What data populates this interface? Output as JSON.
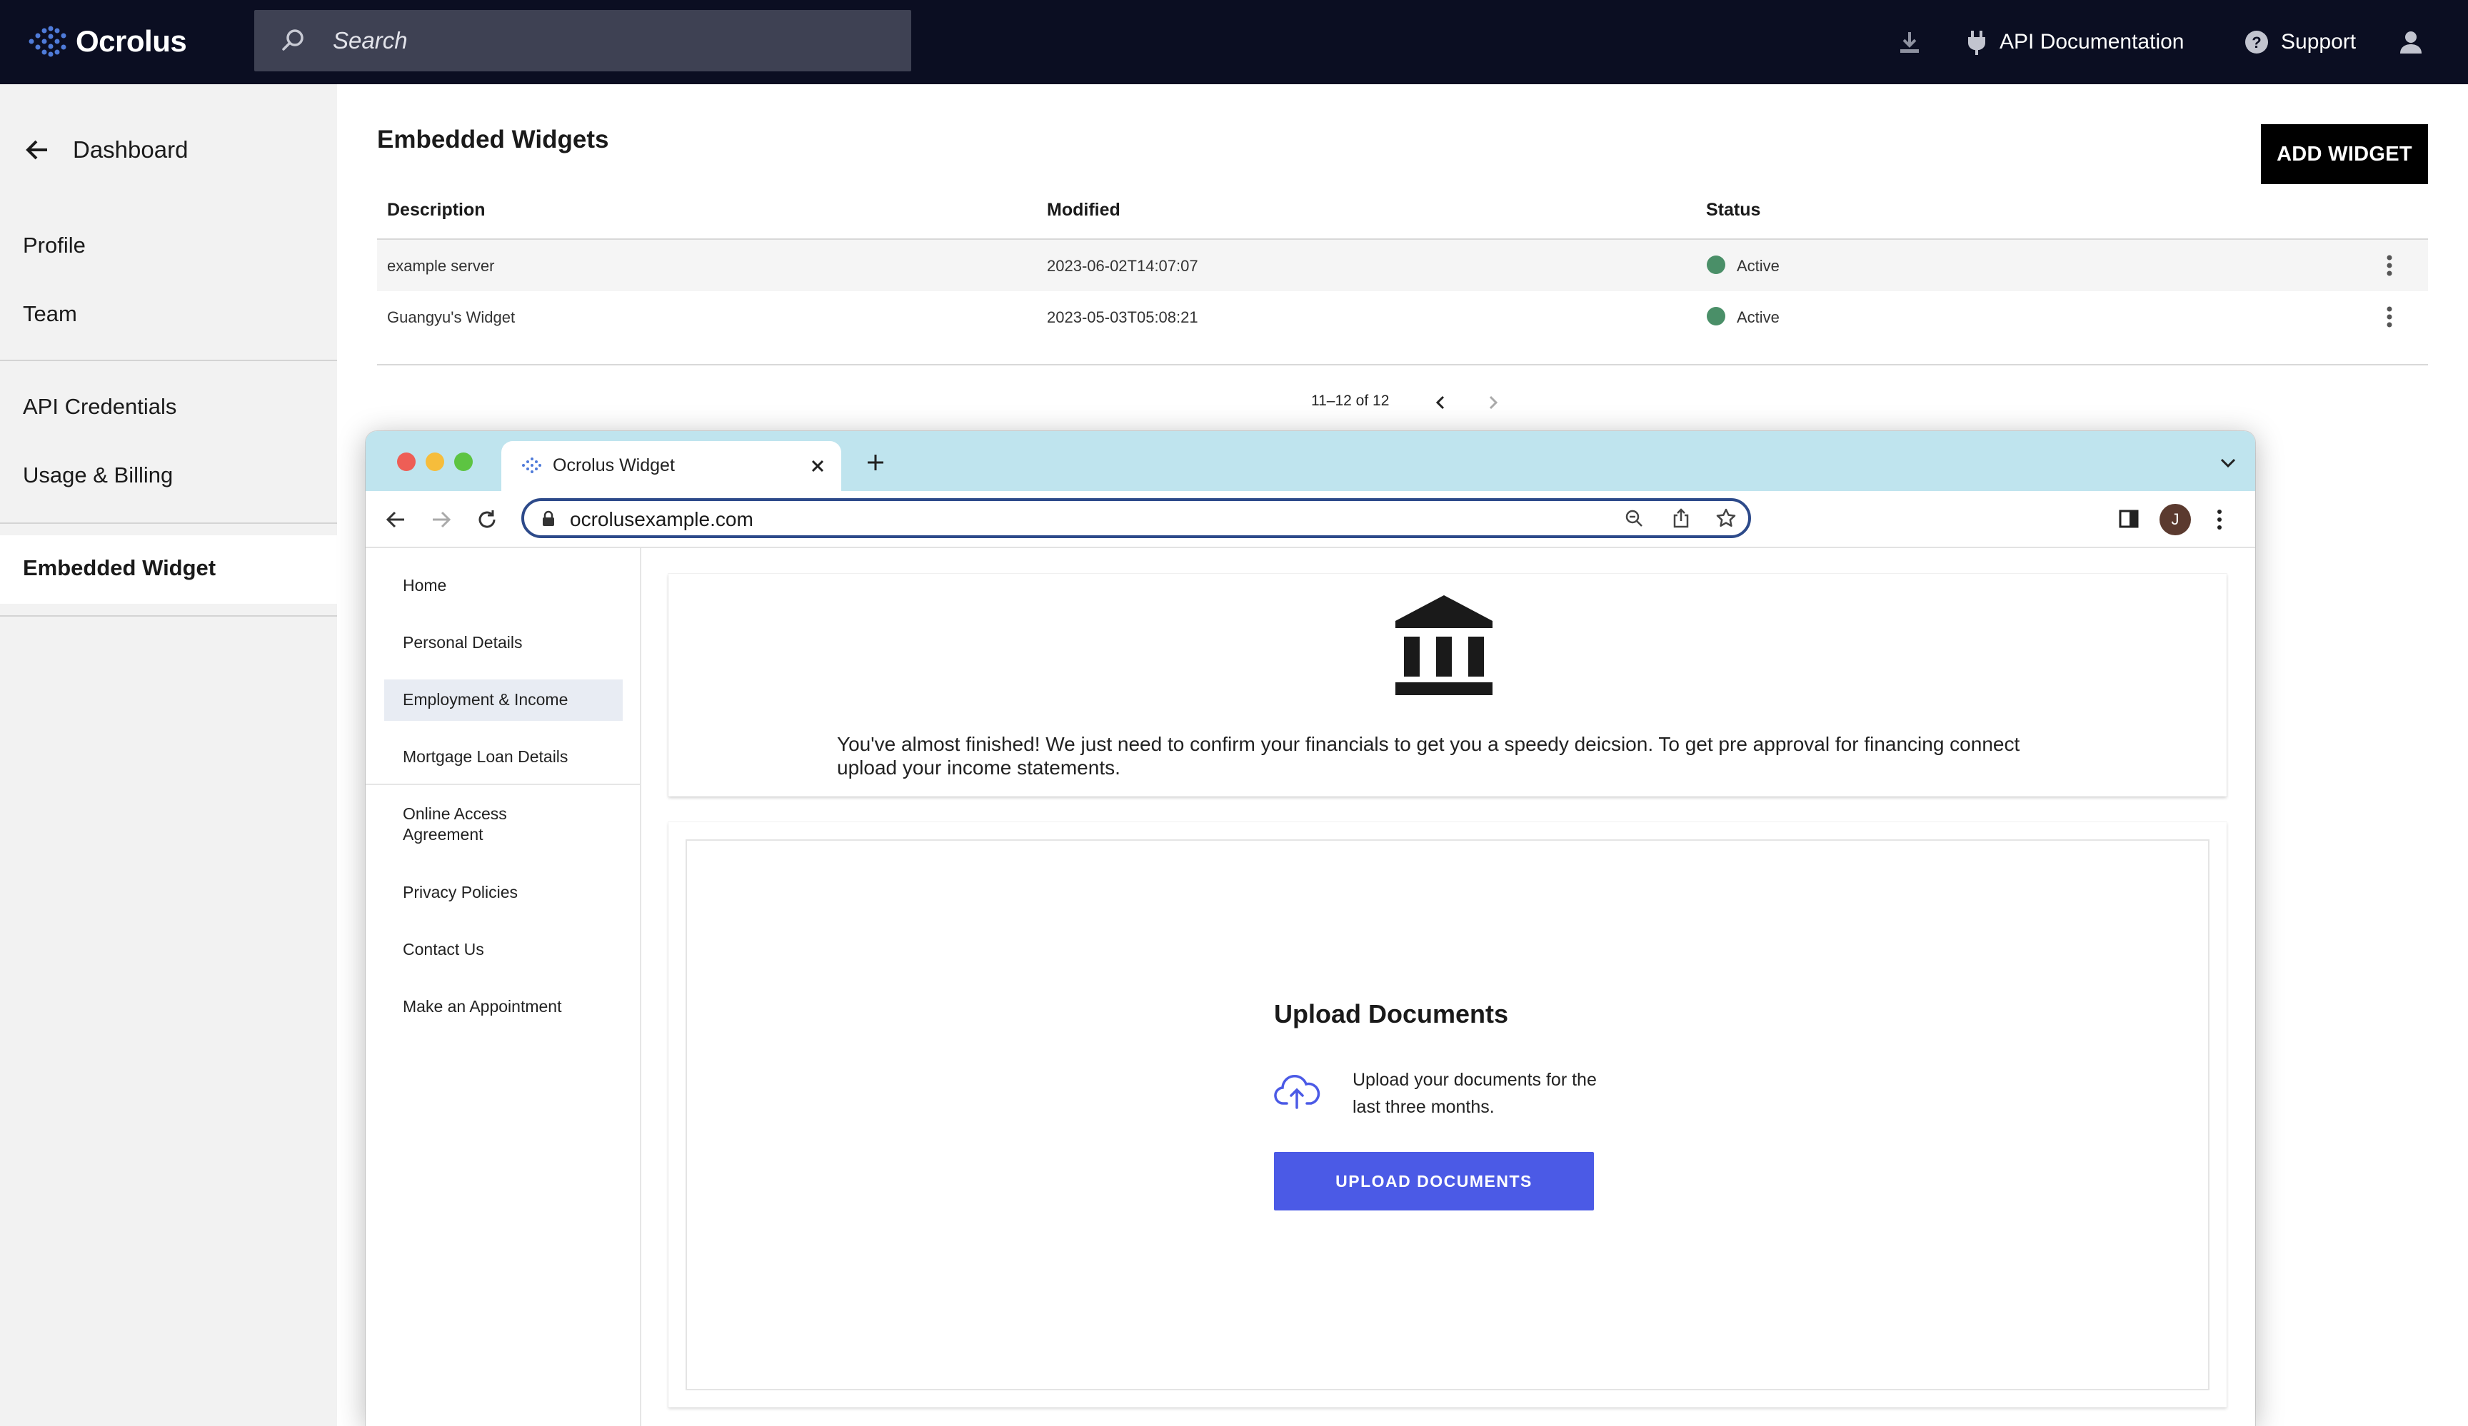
{
  "topbar": {
    "brand": "Ocrolus",
    "search_placeholder": "Search",
    "api_docs": "API Documentation",
    "support": "Support"
  },
  "sidebar": {
    "back_label": "Dashboard",
    "items": [
      "Profile",
      "Team",
      "API Credentials",
      "Usage & Billing",
      "Embedded Widget"
    ],
    "active": "Embedded Widget"
  },
  "main": {
    "title": "Embedded Widgets",
    "add_button": "ADD WIDGET",
    "columns": [
      "Description",
      "Modified",
      "Status"
    ],
    "rows": [
      {
        "description": "example server",
        "modified": "2023-06-02T14:07:07",
        "status": "Active"
      },
      {
        "description": "Guangyu's Widget",
        "modified": "2023-05-03T05:08:21",
        "status": "Active"
      }
    ],
    "pagination": "11–12 of 12"
  },
  "browser": {
    "tab_title": "Ocrolus Widget",
    "url": "ocrolusexample.com",
    "avatar_initial": "J"
  },
  "widget": {
    "nav": [
      "Home",
      "Personal Details",
      "Employment & Income",
      "Mortgage Loan Details",
      "Online Access Agreement",
      "Privacy Policies",
      "Contact Us",
      "Make an Appointment"
    ],
    "active_nav": "Employment & Income",
    "message": "You've almost finished! We just need to confirm your financials to get you a speedy deicsion. To get pre approval for financing connect upload your income statements.",
    "upload": {
      "title": "Upload Documents",
      "description": "Upload your documents for the last three months.",
      "button": "UPLOAD DOCUMENTS"
    }
  },
  "colors": {
    "topbar_bg": "#0b0e22",
    "status_active": "#4a8f68",
    "primary_button": "#4b5ae6",
    "tabstrip": "#bfe4ee"
  }
}
